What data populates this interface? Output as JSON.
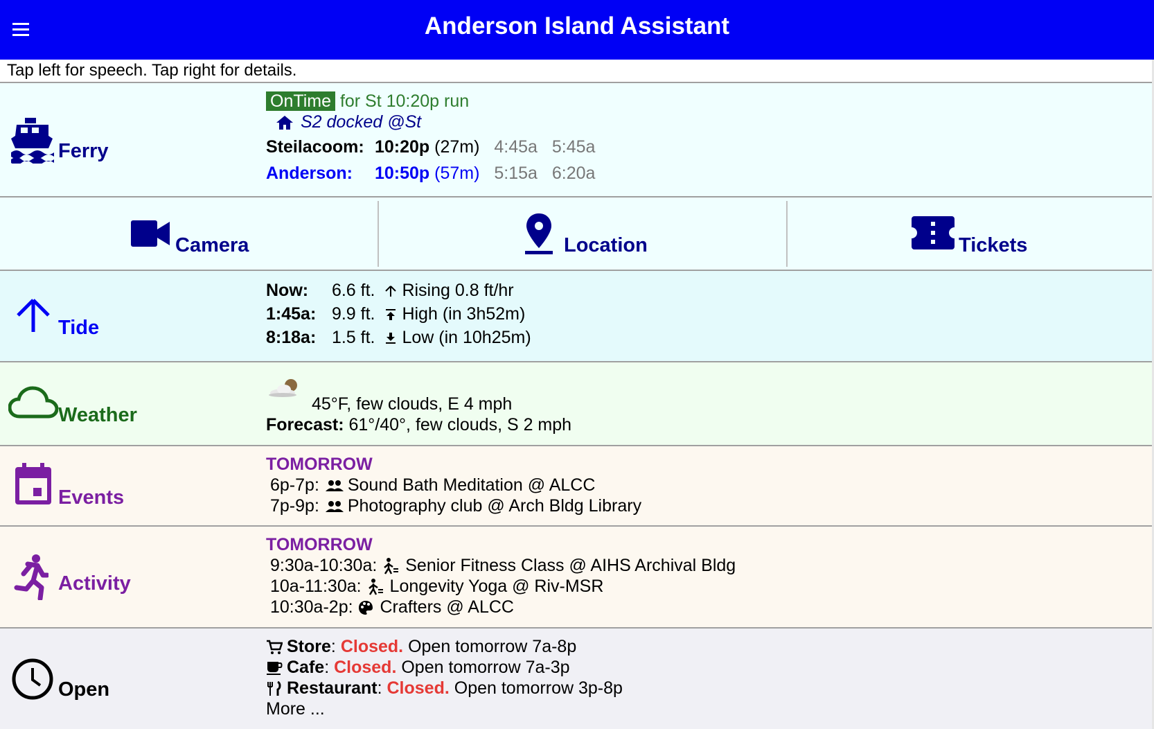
{
  "header": {
    "title": "Anderson Island Assistant",
    "menu_icon": "hamburger-menu-icon",
    "bg_color": "#0000f5"
  },
  "hint": "Tap left for speech. Tap right for details.",
  "ferry": {
    "label": "Ferry",
    "icon": "ship-icon",
    "status_badge": "OnTime",
    "status_text": "for St 10:20p run",
    "vessel_status": "S2 docked @St",
    "steilacoom": {
      "name": "Steilacoom:",
      "next": "10:20p",
      "wait": "(27m)",
      "later": [
        "4:45a",
        "5:45a"
      ]
    },
    "anderson": {
      "name": "Anderson:",
      "next": "10:50p",
      "wait": "(57m)",
      "later": [
        "5:15a",
        "6:20a"
      ]
    }
  },
  "tiles": {
    "camera": {
      "label": "Camera",
      "icon": "video-camera-icon"
    },
    "location": {
      "label": "Location",
      "icon": "map-pin-icon"
    },
    "tickets": {
      "label": "Tickets",
      "icon": "ticket-icon"
    }
  },
  "tide": {
    "label": "Tide",
    "icon": "arrow-up-icon",
    "rows": [
      {
        "time": "Now:",
        "height": "6.6 ft.",
        "desc": "Rising 0.8 ft/hr",
        "icon": "arrow-up-small-icon"
      },
      {
        "time": "1:45a:",
        "height": "9.9 ft.",
        "desc": "High (in 3h52m)",
        "icon": "arrow-to-top-icon"
      },
      {
        "time": "8:18a:",
        "height": "1.5 ft.",
        "desc": "Low (in 10h25m)",
        "icon": "arrow-to-bottom-icon"
      }
    ]
  },
  "weather": {
    "label": "Weather",
    "icon": "cloud-outline-icon",
    "condition_icon": "few-clouds-night-icon",
    "current": "45°F, few clouds, E 4 mph",
    "forecast_label": "Forecast:",
    "forecast": "61°/40°, few clouds, S 2 mph"
  },
  "events": {
    "label": "Events",
    "icon": "calendar-icon",
    "day": "TOMORROW",
    "items": [
      {
        "time": "6p-7p:",
        "icon": "people-icon",
        "text": "Sound Bath Meditation @ ALCC"
      },
      {
        "time": "7p-9p:",
        "icon": "people-icon",
        "text": "Photography club @ Arch Bldg Library"
      }
    ]
  },
  "activity": {
    "label": "Activity",
    "icon": "running-person-icon",
    "day": "TOMORROW",
    "items": [
      {
        "time": "9:30a-10:30a:",
        "icon": "fitness-icon",
        "text": "Senior Fitness Class @ AIHS Archival Bldg"
      },
      {
        "time": "10a-11:30a:",
        "icon": "fitness-icon",
        "text": "Longevity Yoga @ Riv-MSR"
      },
      {
        "time": "10:30a-2p:",
        "icon": "palette-icon",
        "text": "Crafters @ ALCC"
      }
    ]
  },
  "open": {
    "label": "Open",
    "icon": "clock-icon",
    "items": [
      {
        "icon": "cart-icon",
        "name": "Store",
        "status": "Closed.",
        "hours": "Open tomorrow 7a-8p"
      },
      {
        "icon": "coffee-icon",
        "name": "Cafe",
        "status": "Closed.",
        "hours": "Open tomorrow 7a-3p"
      },
      {
        "icon": "fork-knife-icon",
        "name": "Restaurant",
        "status": "Closed.",
        "hours": "Open tomorrow 3p-8p"
      }
    ],
    "more": "More ..."
  }
}
